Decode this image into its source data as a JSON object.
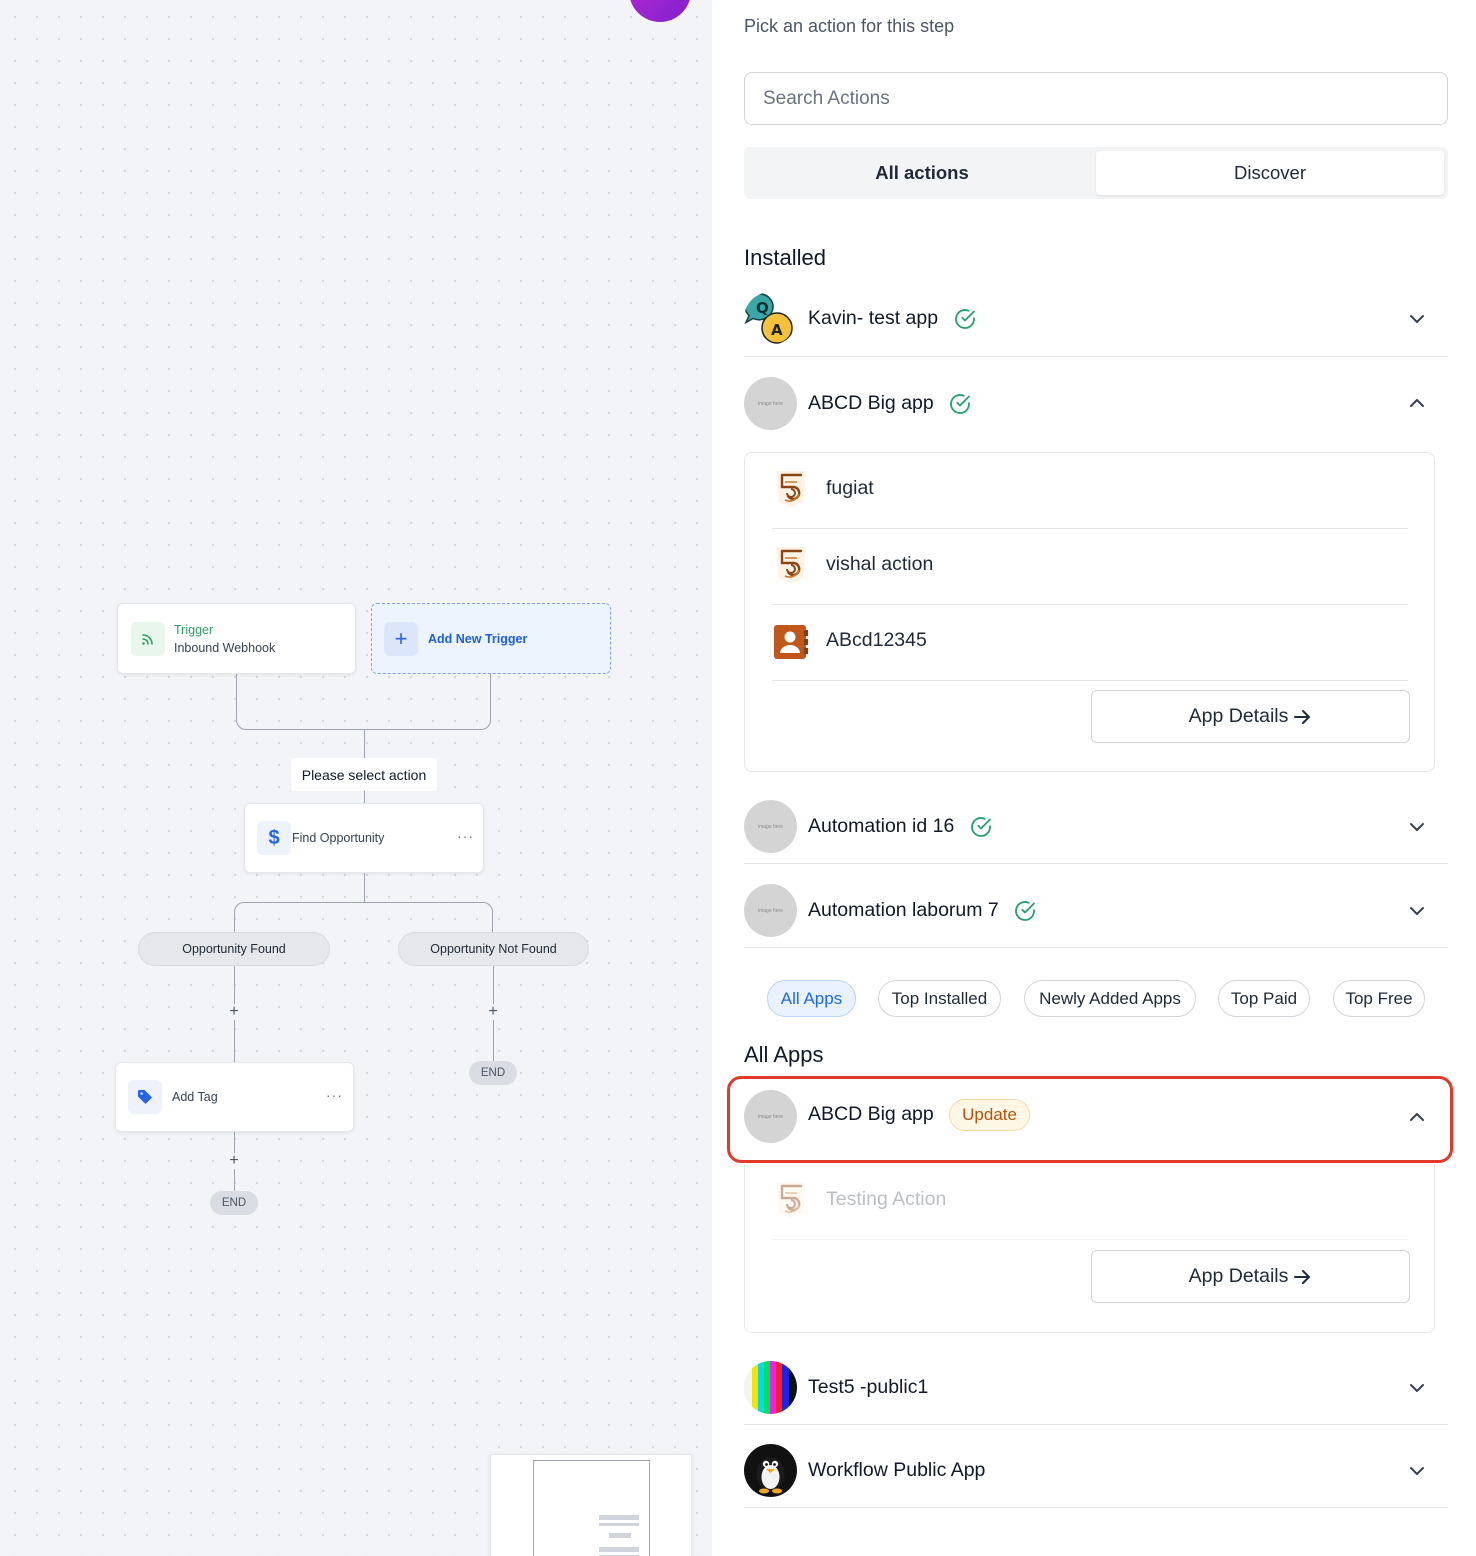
{
  "canvas": {
    "trigger": {
      "label": "Trigger",
      "name": "Inbound Webhook"
    },
    "add_trigger": "Add New Trigger",
    "select_action": "Please select action",
    "find_node": "Find Opportunity",
    "branch_found": "Opportunity Found",
    "branch_not_found": "Opportunity Not Found",
    "add_tag_node": "Add Tag",
    "end_label": "END",
    "node_menu": "···",
    "plus": "+"
  },
  "panel": {
    "prompt": "Pick an action for this step",
    "search_placeholder": "Search Actions",
    "tabs": [
      {
        "label": "All actions",
        "selected": false
      },
      {
        "label": "Discover",
        "selected": true
      }
    ],
    "installed_heading": "Installed",
    "installed": [
      {
        "name": "Kavin- test app",
        "verified": true,
        "expanded": false,
        "icon": "qa-icon"
      },
      {
        "name": "ABCD Big app",
        "verified": true,
        "expanded": true,
        "icon": "placeholder-image",
        "actions": [
          {
            "label": "fugiat",
            "icon": "html5-icon"
          },
          {
            "label": "vishal action",
            "icon": "html5-icon"
          },
          {
            "label": "ABcd12345",
            "icon": "contact-book-icon"
          }
        ],
        "details_button": "App Details"
      },
      {
        "name": "Automation id 16",
        "verified": true,
        "expanded": false,
        "icon": "placeholder-image"
      },
      {
        "name": "Automation laborum 7",
        "verified": true,
        "expanded": false,
        "icon": "placeholder-image"
      }
    ],
    "filters": [
      "All Apps",
      "Top Installed",
      "Newly Added Apps",
      "Top Paid",
      "Top Free"
    ],
    "selected_filter": "All Apps",
    "all_apps_heading": "All Apps",
    "all_apps": [
      {
        "name": "ABCD Big app",
        "badge": "Update",
        "expanded": true,
        "icon": "placeholder-image",
        "actions": [
          {
            "label": "Testing Action",
            "icon": "html5-icon",
            "disabled": true
          }
        ],
        "details_button": "App Details"
      },
      {
        "name": "Test5 -public1",
        "expanded": false,
        "icon": "color-bars-icon"
      },
      {
        "name": "Workflow Public App",
        "expanded": false,
        "icon": "penguin-icon"
      }
    ],
    "placeholder_text": "image here",
    "colors": {
      "accent": "#1d6ae5",
      "verified": "#22a06b",
      "highlight": "#e13a2b",
      "badge": "#b45309"
    }
  }
}
